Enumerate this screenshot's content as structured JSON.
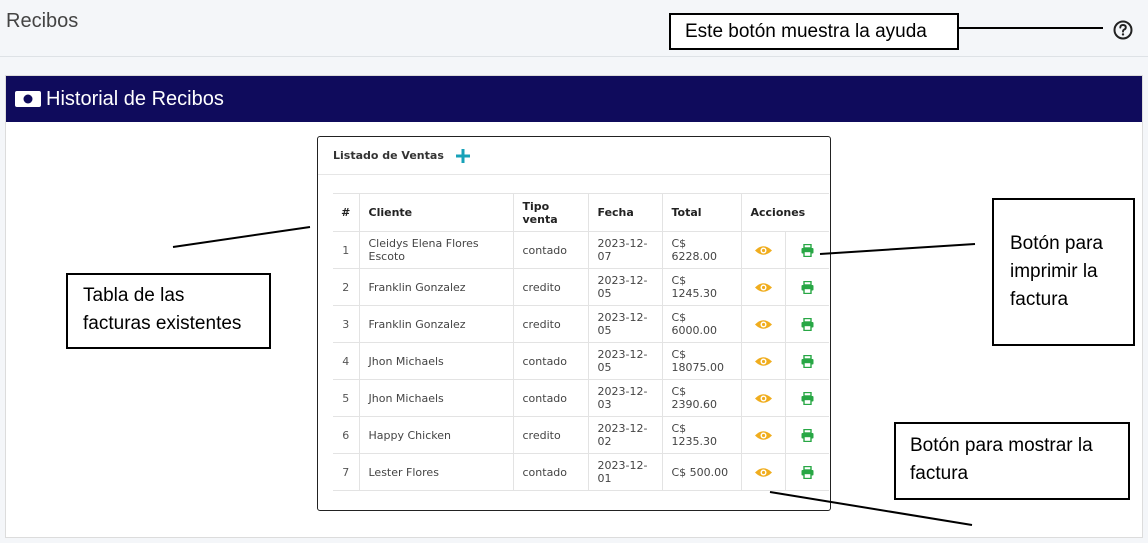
{
  "page": {
    "title": "Recibos"
  },
  "card": {
    "title": "Historial de Recibos"
  },
  "list": {
    "title": "Listado de Ventas",
    "headers": [
      "#",
      "Cliente",
      "Tipo venta",
      "Fecha",
      "Total",
      "Acciones"
    ],
    "rows": [
      {
        "n": "1",
        "cliente": "Cleidys Elena Flores Escoto",
        "tipo": "contado",
        "fecha": "2023-12-07",
        "total": "C$ 6228.00"
      },
      {
        "n": "2",
        "cliente": "Franklin Gonzalez",
        "tipo": "credito",
        "fecha": "2023-12-05",
        "total": "C$ 1245.30"
      },
      {
        "n": "3",
        "cliente": "Franklin Gonzalez",
        "tipo": "credito",
        "fecha": "2023-12-05",
        "total": "C$ 6000.00"
      },
      {
        "n": "4",
        "cliente": "Jhon Michaels",
        "tipo": "contado",
        "fecha": "2023-12-05",
        "total": "C$ 18075.00"
      },
      {
        "n": "5",
        "cliente": "Jhon Michaels",
        "tipo": "contado",
        "fecha": "2023-12-03",
        "total": "C$ 2390.60"
      },
      {
        "n": "6",
        "cliente": "Happy Chicken",
        "tipo": "credito",
        "fecha": "2023-12-02",
        "total": "C$ 1235.30"
      },
      {
        "n": "7",
        "cliente": "Lester Flores",
        "tipo": "contado",
        "fecha": "2023-12-01",
        "total": "C$ 500.00"
      }
    ]
  },
  "annotations": {
    "help": "Este botón muestra la ayuda",
    "table": "Tabla de las facturas existentes",
    "print": "Botón para imprimir la factura",
    "show": "Botón para mostrar la factura"
  },
  "icons": {
    "help": "question-circle-icon",
    "header": "money-bill-icon",
    "add": "plus-icon",
    "view": "eye-icon",
    "print": "printer-icon"
  },
  "colors": {
    "header_bg": "#0f0b5c",
    "add": "#17a2b8",
    "view": "#f0ad1e",
    "print": "#28a745"
  }
}
